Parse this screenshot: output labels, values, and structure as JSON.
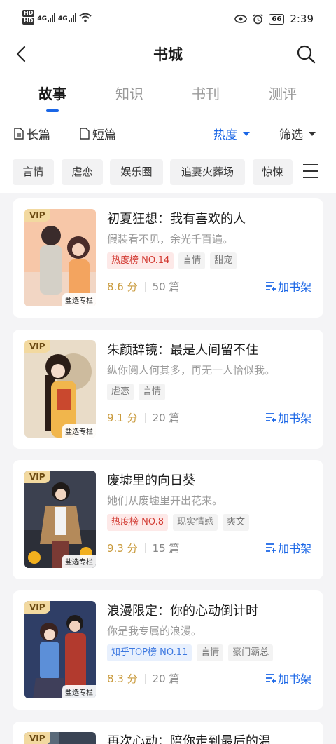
{
  "status_bar": {
    "network1": "4G",
    "network2": "4G",
    "battery": "66",
    "time": "2:39"
  },
  "header": {
    "title": "书城"
  },
  "tabs": [
    {
      "label": "故事"
    },
    {
      "label": "知识"
    },
    {
      "label": "书刊"
    },
    {
      "label": "测评"
    }
  ],
  "filters": {
    "long": "长篇",
    "short": "短篇",
    "sort": "热度",
    "screen": "筛选"
  },
  "chips": [
    "言情",
    "虐恋",
    "娱乐圈",
    "追妻火葬场",
    "惊悚"
  ],
  "books": [
    {
      "title": "初夏狂想：我有喜欢的人",
      "desc": "假装看不见，余光千百遍。",
      "tags": [
        "热度榜 NO.14",
        "言情",
        "甜宠"
      ],
      "score": "8.6 分",
      "count": "50 篇",
      "badge": "VIP",
      "cover_label": "盐选专栏",
      "add_label": "加书架"
    },
    {
      "title": "朱颜辞镜：最是人间留不住",
      "desc": "纵你阅人何其多，再无一人恰似我。",
      "tags": [
        "虐恋",
        "言情"
      ],
      "score": "9.1 分",
      "count": "20 篇",
      "badge": "VIP",
      "cover_label": "盐选专栏",
      "add_label": "加书架"
    },
    {
      "title": "废墟里的向日葵",
      "desc": "她们从废墟里开出花来。",
      "tags": [
        "热度榜 NO.8",
        "现实情感",
        "爽文"
      ],
      "score": "9.3 分",
      "count": "15 篇",
      "badge": "VIP",
      "cover_label": "盐选专栏",
      "add_label": "加书架"
    },
    {
      "title": "浪漫限定：你的心动倒计时",
      "desc": "你是我专属的浪漫。",
      "tags": [
        "知乎TOP榜 NO.11",
        "言情",
        "豪门霸总"
      ],
      "score": "8.3 分",
      "count": "20 篇",
      "badge": "VIP",
      "cover_label": "盐选专栏",
      "add_label": "加书架"
    },
    {
      "title": "再次心动：陪你走到最后的温",
      "badge": "VIP"
    }
  ]
}
